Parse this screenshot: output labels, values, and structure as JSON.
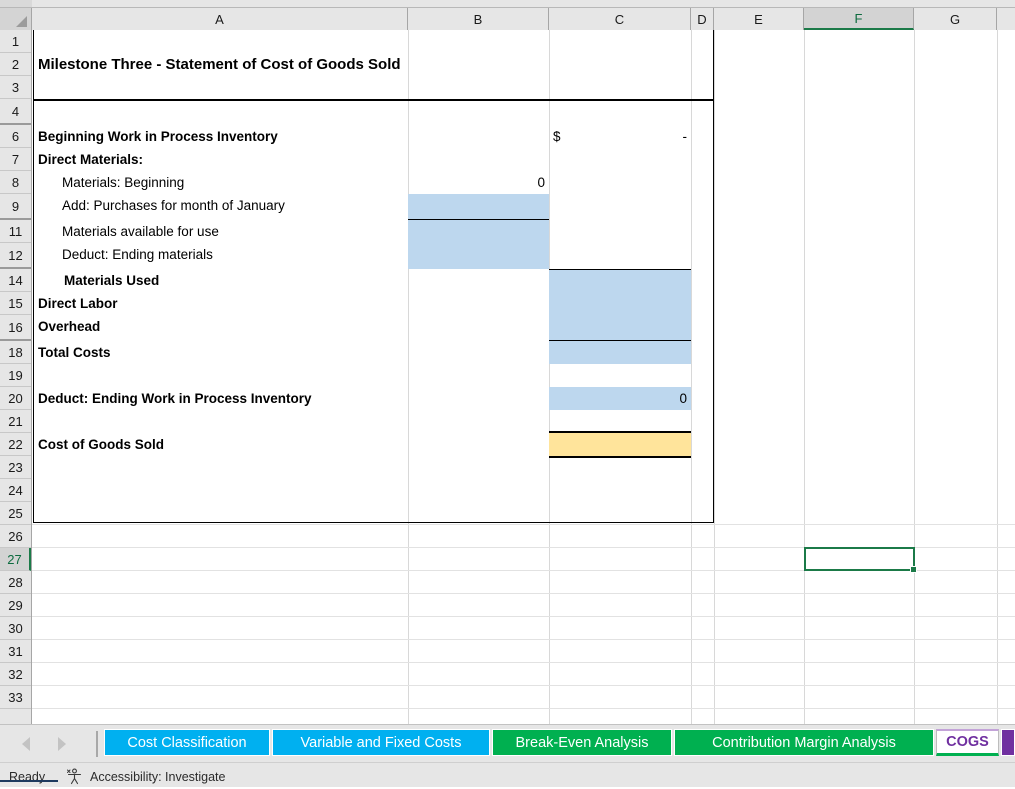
{
  "app": {
    "type": "spreadsheet",
    "active_cell": "F27",
    "status": "Ready",
    "accessibility": "Accessibility: Investigate"
  },
  "grid": {
    "column_headers": [
      "A",
      "B",
      "C",
      "D",
      "E",
      "F",
      "G"
    ],
    "selected_column": "F",
    "row_headers": [
      "1",
      "2",
      "3",
      "4",
      "6",
      "7",
      "8",
      "9",
      "11",
      "12",
      "14",
      "15",
      "16",
      "18",
      "19",
      "20",
      "21",
      "22",
      "23",
      "24",
      "25",
      "26",
      "27",
      "28",
      "29",
      "30",
      "31",
      "32",
      "33"
    ],
    "selected_row": "27",
    "hidden_rows": [
      "5",
      "10",
      "13",
      "17"
    ]
  },
  "sheet": {
    "title": "Milestone Three - Statement of Cost of Goods Sold",
    "rows": [
      {
        "row": "6",
        "label": "Beginning Work in Process Inventory",
        "bold": true,
        "indent": 0,
        "c_symbol": "$",
        "c_value": "-"
      },
      {
        "row": "7",
        "label": "Direct Materials:",
        "bold": true,
        "indent": 0
      },
      {
        "row": "8",
        "label": "Materials: Beginning",
        "bold": false,
        "indent": 1,
        "b_value": "0"
      },
      {
        "row": "9",
        "label": "Add: Purchases for month of January",
        "bold": false,
        "indent": 1,
        "b_value": ""
      },
      {
        "row": "11",
        "label": "Materials available for use",
        "bold": false,
        "indent": 1,
        "b_value": ""
      },
      {
        "row": "12",
        "label": "Deduct: Ending materials",
        "bold": false,
        "indent": 1,
        "b_value": ""
      },
      {
        "row": "14",
        "label": "Materials Used",
        "bold": true,
        "indent": 1,
        "c_value": ""
      },
      {
        "row": "15",
        "label": "Direct Labor",
        "bold": true,
        "indent": 0,
        "c_value": ""
      },
      {
        "row": "16",
        "label": "Overhead",
        "bold": true,
        "indent": 0,
        "c_value": ""
      },
      {
        "row": "18",
        "label": "Total Costs",
        "bold": true,
        "indent": 0,
        "c_value": ""
      },
      {
        "row": "20",
        "label": "Deduct: Ending Work in Process Inventory",
        "bold": true,
        "indent": 0,
        "c_value": "0"
      },
      {
        "row": "22",
        "label": "Cost of Goods Sold",
        "bold": true,
        "indent": 0,
        "c_value": ""
      }
    ]
  },
  "colors": {
    "input_fill": "#BDD7EE",
    "result_fill": "#FFE49B",
    "tab_cyan": "#00B0F0",
    "tab_green": "#00B050",
    "tab_purple": "#7030A0",
    "selection_green": "#1B7A48"
  },
  "tabs": [
    {
      "label": "Cost Classification",
      "style": "cyan",
      "active": false
    },
    {
      "label": "Variable and Fixed Costs",
      "style": "cyan",
      "active": false
    },
    {
      "label": "Break-Even Analysis",
      "style": "green",
      "active": false
    },
    {
      "label": "Contribution Margin Analysis",
      "style": "green",
      "active": false
    },
    {
      "label": "COGS",
      "style": "active",
      "active": true
    }
  ],
  "nav": {
    "prev_icon": "chevron-left-icon",
    "next_icon": "chevron-right-icon"
  }
}
